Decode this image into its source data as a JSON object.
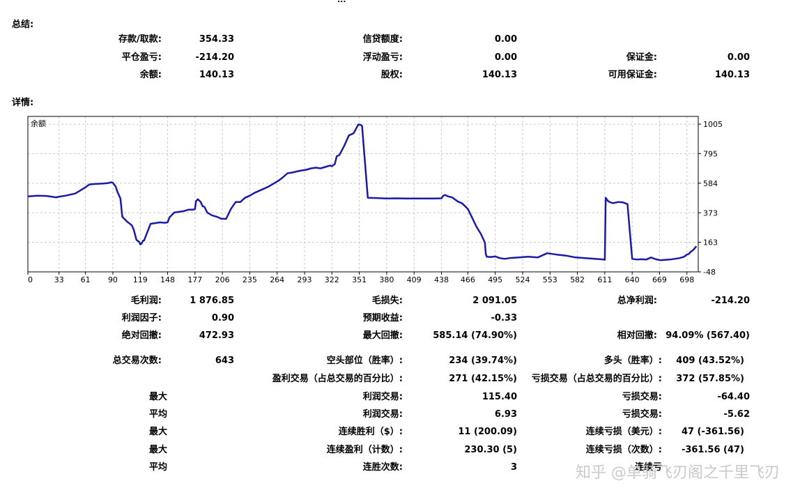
{
  "top_fragment": "...",
  "summary": {
    "title": "总结:",
    "rows": [
      [
        {
          "label": "存款/取款:",
          "value": "354.33"
        },
        {
          "label": "信贷额度:",
          "value": "0.00"
        },
        {
          "label": "",
          "value": ""
        }
      ],
      [
        {
          "label": "平仓盈亏:",
          "value": "-214.20"
        },
        {
          "label": "浮动盈亏:",
          "value": "0.00"
        },
        {
          "label": "保证金:",
          "value": "0.00"
        }
      ],
      [
        {
          "label": "余额:",
          "value": "140.13"
        },
        {
          "label": "股权:",
          "value": "140.13"
        },
        {
          "label": "可用保证金:",
          "value": "140.13"
        }
      ]
    ]
  },
  "details": {
    "title": "详情:",
    "rows": [
      [
        {
          "label": "毛利润:",
          "value": "1 876.85"
        },
        {
          "label": "毛损失:",
          "value": "2 091.05"
        },
        {
          "label": "总净利润:",
          "value": "-214.20"
        }
      ],
      [
        {
          "label": "利润因子:",
          "value": "0.90"
        },
        {
          "label": "预期收益:",
          "value": "-0.33"
        },
        {
          "label": "",
          "value": ""
        }
      ],
      [
        {
          "label": "绝对回撤:",
          "value": "472.93"
        },
        {
          "label": "最大回撤:",
          "value": "585.14 (74.90%)"
        },
        {
          "label": "相对回撤:",
          "value": "94.09% (567.40)"
        }
      ],
      [
        {
          "label": "总交易次数:",
          "value": "643"
        },
        {
          "label": "空头部位（胜率）:",
          "value": "234 (39.74%)"
        },
        {
          "label": "多头（胜率）:",
          "value": "409 (43.52%)"
        }
      ],
      [
        {
          "label": "",
          "value": ""
        },
        {
          "label": "盈利交易（占总交易的百分比）:",
          "value": "271 (42.15%)"
        },
        {
          "label": "亏损交易（占总交易的百分比）:",
          "value": "372 (57.85%)"
        }
      ],
      [
        {
          "label": "最大",
          "value": ""
        },
        {
          "label": "利润交易:",
          "value": "115.40"
        },
        {
          "label": "亏损交易:",
          "value": "-64.40"
        }
      ],
      [
        {
          "label": "平均",
          "value": ""
        },
        {
          "label": "利润交易:",
          "value": "6.93"
        },
        {
          "label": "亏损交易:",
          "value": "-5.62"
        }
      ],
      [
        {
          "label": "最大",
          "value": ""
        },
        {
          "label": "连续胜利（$）:",
          "value": "11 (200.09)"
        },
        {
          "label": "连续亏损（美元）:",
          "value": "47 (-361.56)"
        }
      ],
      [
        {
          "label": "最大",
          "value": ""
        },
        {
          "label": "连续盈利（计数）:",
          "value": "230.30 (5)"
        },
        {
          "label": "连续亏损（次数）:",
          "value": "-361.56 (47)"
        }
      ],
      [
        {
          "label": "平均",
          "value": ""
        },
        {
          "label": "连胜次数:",
          "value": "3"
        },
        {
          "label": "连续亏",
          "value": ""
        }
      ]
    ]
  },
  "watermark": "知乎 @单骑飞刃阁之千里飞刃",
  "colors": {
    "line": "#1a1aa8",
    "grid": "#c8c8c8",
    "frame": "#000000"
  },
  "chart_data": {
    "type": "line",
    "title": "",
    "legend_label": "余额",
    "xlabel": "",
    "ylabel": "",
    "x_ticks": [
      "0",
      "33",
      "61",
      "90",
      "119",
      "148",
      "177",
      "206",
      "235",
      "264",
      "293",
      "322",
      "351",
      "380",
      "409",
      "438",
      "466",
      "495",
      "524",
      "553",
      "582",
      "611",
      "640",
      "669",
      "698"
    ],
    "y_ticks": [
      "1005",
      "795",
      "584",
      "373",
      "163",
      "-48"
    ],
    "xlim": [
      0,
      710
    ],
    "ylim": [
      -48,
      1060
    ],
    "grid": true,
    "series": [
      {
        "x": [
          0,
          10,
          20,
          30,
          33,
          40,
          50,
          55,
          61,
          65,
          70,
          75,
          80,
          85,
          88,
          90,
          93,
          95,
          98,
          100,
          105,
          110,
          112,
          115,
          118,
          119,
          120,
          121,
          122,
          123,
          125,
          130,
          140,
          145,
          148,
          150,
          155,
          160,
          165,
          170,
          175,
          177,
          178,
          180,
          183,
          185,
          187,
          190,
          195,
          200,
          205,
          210,
          215,
          220,
          225,
          230,
          235,
          240,
          245,
          250,
          255,
          260,
          265,
          270,
          275,
          280,
          285,
          290,
          295,
          300,
          305,
          310,
          315,
          320,
          322,
          325,
          327,
          330,
          335,
          340,
          345,
          350,
          351,
          352,
          353,
          354,
          360,
          370,
          380,
          390,
          400,
          410,
          420,
          430,
          438,
          440,
          442,
          445,
          448,
          450,
          455,
          460,
          466,
          470,
          475,
          480,
          484,
          485,
          486,
          490,
          495,
          500,
          505,
          510,
          520,
          530,
          540,
          545,
          550,
          555,
          560,
          570,
          580,
          590,
          600,
          610,
          611,
          612,
          613,
          614,
          615,
          616,
          617,
          618,
          620,
          622,
          625,
          630,
          635,
          640,
          645,
          650,
          655,
          660,
          665,
          670,
          675,
          680,
          685,
          690,
          695,
          698,
          700,
          702,
          705,
          708
        ],
        "y": [
          490,
          495,
          493,
          483,
          488,
          495,
          510,
          530,
          555,
          575,
          578,
          580,
          582,
          585,
          590,
          588,
          560,
          520,
          475,
          345,
          310,
          285,
          255,
          180,
          165,
          148,
          150,
          160,
          175,
          175,
          210,
          295,
          305,
          302,
          305,
          340,
          375,
          380,
          385,
          395,
          395,
          400,
          455,
          470,
          450,
          420,
          415,
          375,
          355,
          345,
          330,
          330,
          400,
          450,
          450,
          480,
          495,
          515,
          530,
          545,
          560,
          580,
          600,
          625,
          655,
          660,
          668,
          675,
          680,
          690,
          695,
          690,
          700,
          710,
          705,
          720,
          775,
          785,
          850,
          925,
          940,
          1003,
          1002,
          1000,
          998,
          990,
          480,
          478,
          475,
          476,
          475,
          475,
          475,
          475,
          476,
          495,
          500,
          490,
          485,
          480,
          455,
          440,
          400,
          345,
          275,
          220,
          160,
          80,
          60,
          58,
          62,
          50,
          45,
          50,
          55,
          60,
          55,
          70,
          85,
          80,
          75,
          68,
          55,
          50,
          45,
          40,
          38,
          480,
          470,
          460,
          455,
          450,
          448,
          445,
          442,
          445,
          450,
          448,
          435,
          45,
          40,
          42,
          40,
          55,
          42,
          35,
          38,
          40,
          45,
          50,
          60,
          75,
          80,
          95,
          110,
          135
        ]
      }
    ]
  }
}
